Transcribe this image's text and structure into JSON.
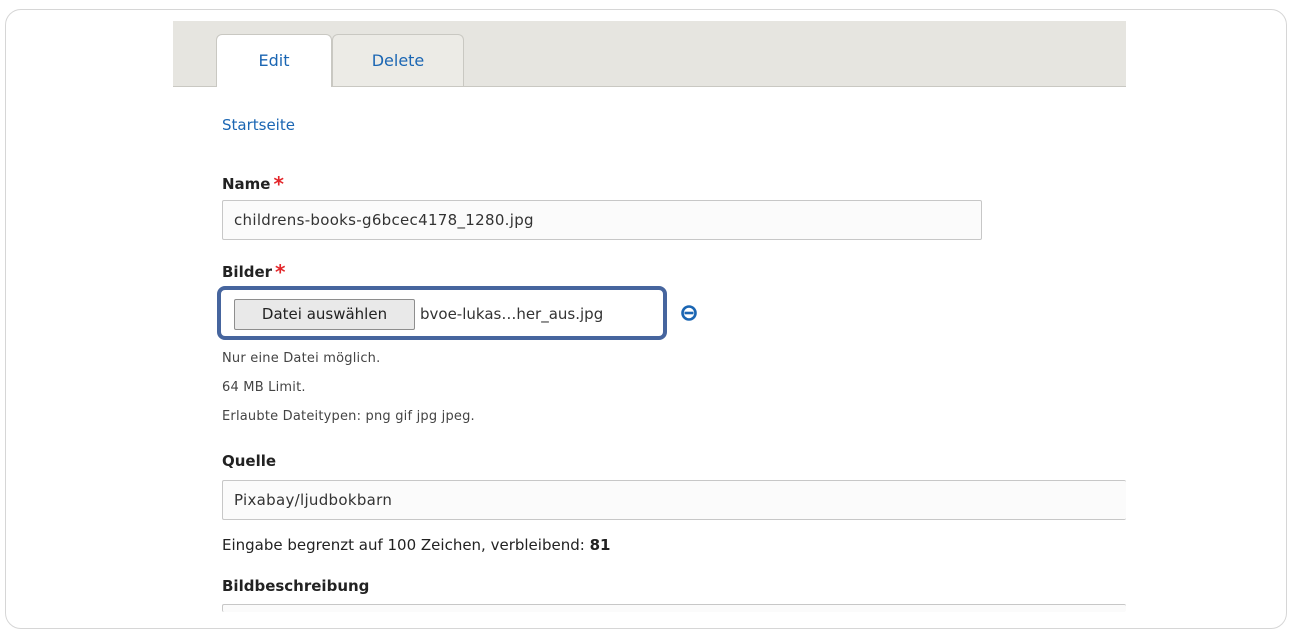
{
  "tabs": [
    {
      "label": "Edit",
      "active": true
    },
    {
      "label": "Delete",
      "active": false
    }
  ],
  "breadcrumb": "Startseite",
  "fields": {
    "name": {
      "label": "Name",
      "required_mark": "*",
      "value": "childrens-books-g6bcec4178_1280.jpg"
    },
    "images": {
      "label": "Bilder",
      "required_mark": "*",
      "button_label": "Datei auswählen",
      "file_name": "bvoe-lukas…her_aus.jpg",
      "remove_icon": "remove-circle-icon",
      "help": [
        "Nur eine Datei möglich.",
        "64 MB Limit.",
        "Erlaubte Dateitypen: png gif jpg jpeg."
      ]
    },
    "source": {
      "label": "Quelle",
      "value": "Pixabay/ljudbokbarn",
      "counter_text": "Eingabe begrenzt auf 100 Zeichen, verbleibend:",
      "counter_value": "81"
    },
    "description": {
      "label": "Bildbeschreibung"
    }
  },
  "colors": {
    "link": "#1b66b3",
    "required": "#e3262a",
    "highlight": "#46659e",
    "tabbar": "#e6e5e0"
  }
}
